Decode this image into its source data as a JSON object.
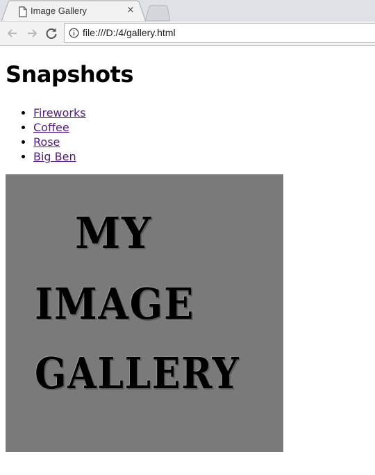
{
  "browser": {
    "tab_title": "Image Gallery",
    "tab_close_glyph": "×",
    "url": "file:///D:/4/gallery.html"
  },
  "page": {
    "heading": "Snapshots",
    "links": [
      {
        "label": "Fireworks"
      },
      {
        "label": "Coffee"
      },
      {
        "label": "Rose"
      },
      {
        "label": "Big Ben"
      }
    ],
    "placeholder": {
      "lines": [
        "MY",
        "IMAGE",
        "GALLERY"
      ],
      "background": "#7a7a7a"
    }
  },
  "colors": {
    "visited_link": "#551a8b",
    "chrome_bg": "#dee1e6",
    "toolbar_bg": "#f2f2f2"
  },
  "icons": [
    "document-icon",
    "close-icon",
    "back-icon",
    "forward-icon",
    "reload-icon",
    "info-icon"
  ]
}
